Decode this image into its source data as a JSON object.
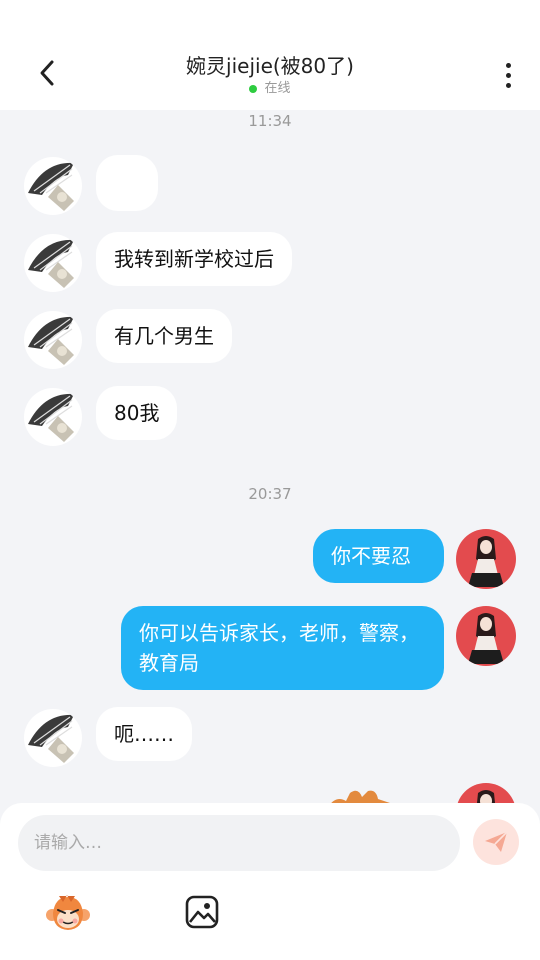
{
  "header": {
    "title": "婉灵jiejie(被80了)",
    "status_text": "在线",
    "status_color": "#2ecc40"
  },
  "messages": {
    "timestamp_1": "11:34",
    "msg_1": "",
    "msg_2": "我转到新学校过后",
    "msg_3": "有几个男生",
    "msg_4": "80我",
    "timestamp_2": "20:37",
    "msg_5": "你不要忍",
    "msg_6": "你可以告诉家长，老师，警察，教育局",
    "msg_7": "呃……"
  },
  "input": {
    "placeholder": "请输入…"
  },
  "colors": {
    "outgoing_bubble": "#23b3f5",
    "incoming_bubble": "#ffffff",
    "background": "#f3f4f7",
    "send_button": "#fde3dd",
    "send_icon": "#f5a893",
    "self_avatar_bg": "#e34b4e"
  },
  "icons": {
    "back": "chevron-left-icon",
    "more": "more-vertical-icon",
    "send": "paper-plane-icon",
    "emoji": "monkey-face-icon",
    "image": "image-icon"
  }
}
